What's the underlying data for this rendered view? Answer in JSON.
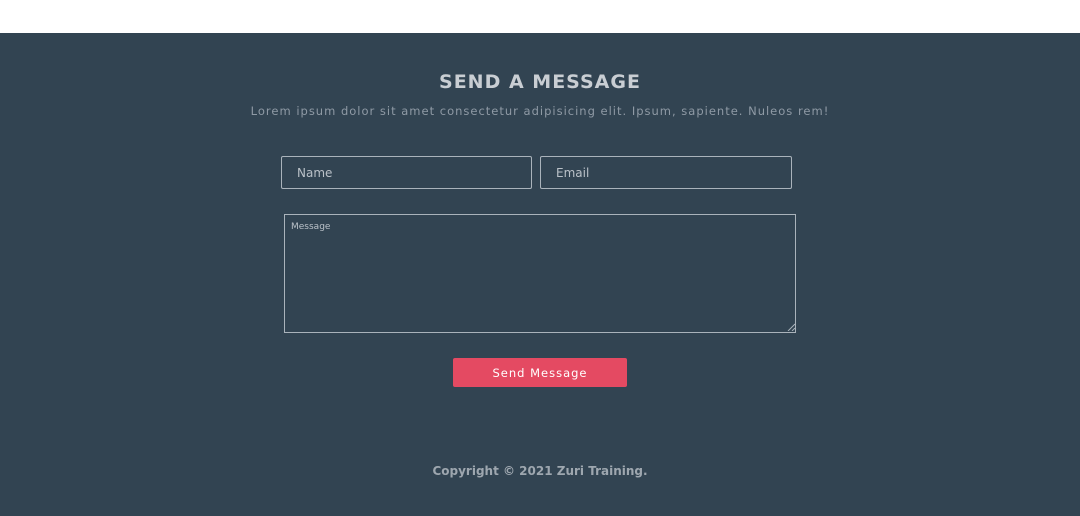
{
  "contact": {
    "heading": "SEND A MESSAGE",
    "subtext": "Lorem ipsum dolor sit amet consectetur adipisicing elit. Ipsum, sapiente. Nuleos rem!",
    "name_placeholder": "Name",
    "email_placeholder": "Email",
    "message_placeholder": "Message",
    "send_label": "Send Message"
  },
  "footer": {
    "copyright": "Copyright © 2021 Zuri Training."
  },
  "colors": {
    "background": "#324452",
    "accent": "#e44a62",
    "heading_text": "#c9ced3"
  }
}
